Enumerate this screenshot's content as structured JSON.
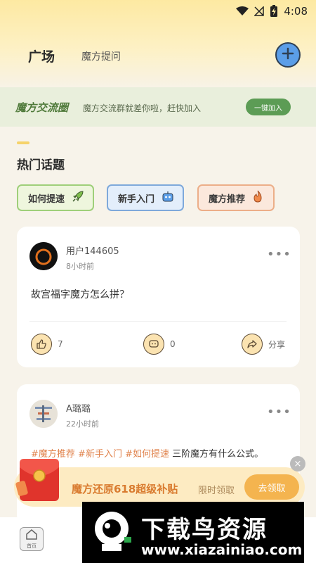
{
  "status_bar": {
    "time": "4:08"
  },
  "nav": {
    "active_tab": "广场",
    "tab2": "魔方提问"
  },
  "group_banner": {
    "title": "魔方交流圈",
    "subtitle": "魔方交流群就差你啦，赶快加入",
    "button": "一键加入"
  },
  "hot_section": {
    "title": "热门话题"
  },
  "topics": [
    {
      "label": "如何提速",
      "icon": "rocket-icon"
    },
    {
      "label": "新手入门",
      "icon": "robot-icon"
    },
    {
      "label": "魔方推荐",
      "icon": "fire-icon"
    }
  ],
  "posts": [
    {
      "username": "用户144605",
      "time": "8小时前",
      "text": "故宫福字魔方怎么拼？",
      "likes": "7",
      "comments": "0",
      "share_label": "分享"
    },
    {
      "username": "A璐璐",
      "time": "22小时前",
      "tags": [
        "#魔方推荐",
        "#新手入门",
        "#如何提速"
      ],
      "text": "三阶魔方有什么公式。"
    }
  ],
  "promo": {
    "title": "魔方还原618超级补贴",
    "subtitle": "限时领取",
    "button": "去领取"
  },
  "bottom_nav": {
    "home_label": "首页"
  },
  "watermark": {
    "title": "下载鸟资源",
    "url": "www.xiazainiao.com"
  },
  "colors": {
    "accent_blue": "#5b9ee8",
    "banner_green": "#5c9c55",
    "tag_orange": "#e0824b",
    "promo_button": "#f4b44f"
  }
}
